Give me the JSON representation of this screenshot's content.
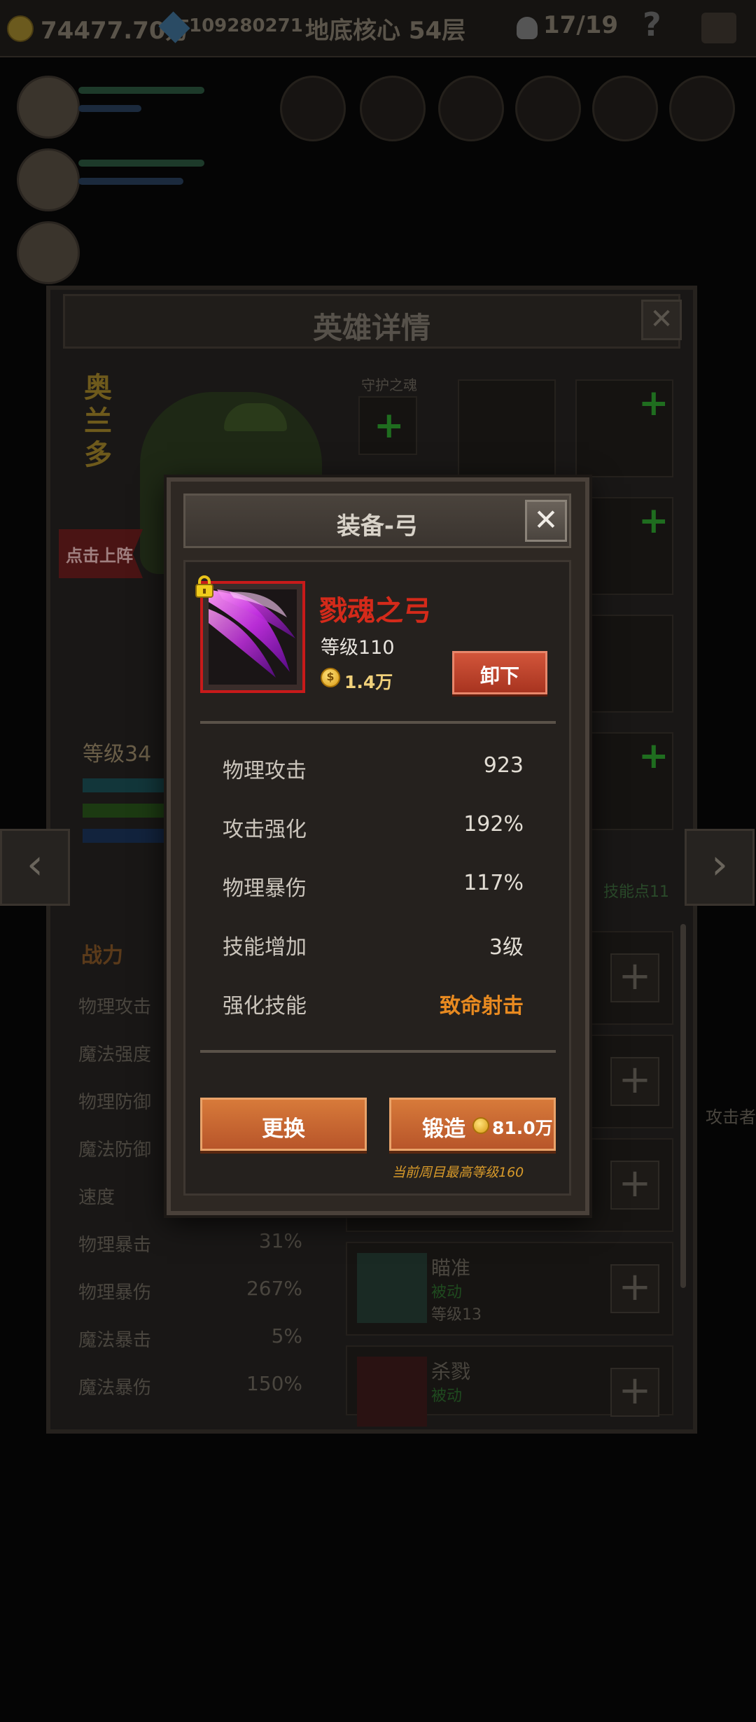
{
  "topbar": {
    "gold": "74477.70万",
    "gems": "109280271",
    "location": "地底核心 54层",
    "skull_count": "17/19",
    "help": "?"
  },
  "hero_panel": {
    "title": "英雄详情",
    "close": "✕",
    "hero_name": "奥兰多",
    "guard_soul_label": "守护之魂",
    "deploy_label": "点击上阵",
    "level_label": "等级34",
    "skill_points": "技能点11",
    "stats_header": "战力",
    "stats": [
      {
        "label": "物理攻击",
        "value": ""
      },
      {
        "label": "魔法强度",
        "value": ""
      },
      {
        "label": "物理防御",
        "value": ""
      },
      {
        "label": "魔法防御",
        "value": ""
      },
      {
        "label": "速度",
        "value": ""
      },
      {
        "label": "物理暴击",
        "value": "31%"
      },
      {
        "label": "物理暴伤",
        "value": "267%"
      },
      {
        "label": "魔法暴击",
        "value": "5%"
      },
      {
        "label": "魔法暴伤",
        "value": "150%"
      }
    ],
    "skills": [
      {
        "name": "瞄准",
        "type": "被动",
        "level": "等级13"
      },
      {
        "name": "杀戮",
        "type": "被动",
        "level": ""
      }
    ],
    "side_text": "攻击者"
  },
  "dialog": {
    "title": "装备-弓",
    "close": "✕",
    "item": {
      "name": "戮魂之弓",
      "level": "等级110",
      "price": "1.4万",
      "locked": true
    },
    "unequip_label": "卸下",
    "stats": [
      {
        "label": "物理攻击",
        "value": "923"
      },
      {
        "label": "攻击强化",
        "value": "192%"
      },
      {
        "label": "物理暴伤",
        "value": "117%"
      },
      {
        "label": "技能增加",
        "value": "3级"
      },
      {
        "label": "强化技能",
        "value": "致命射击"
      }
    ],
    "replace_label": "更换",
    "forge_label": "锻造",
    "forge_cost": "81.0万",
    "max_level_note": "当前周目最高等级160"
  },
  "colors": {
    "item_name": "#d42a1a",
    "highlight_skill": "#e88a20",
    "button_orange": "#c8632e",
    "frame_red": "#c81a1a"
  }
}
